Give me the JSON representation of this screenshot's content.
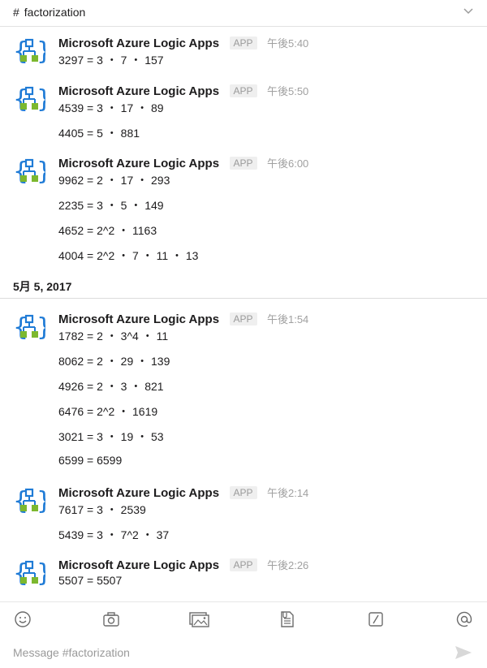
{
  "channel": {
    "hash": "#",
    "name": "factorization"
  },
  "app_name": "Microsoft Azure Logic Apps",
  "app_badge": "APP",
  "groups": [
    {
      "time": "午後5:40",
      "messages": [
        "3297 = 3 ・ 7 ・ 157"
      ]
    },
    {
      "time": "午後5:50",
      "messages": [
        "4539 = 3 ・ 17 ・ 89",
        "4405 = 5 ・ 881"
      ]
    },
    {
      "time": "午後6:00",
      "messages": [
        "9962 = 2 ・ 17 ・ 293",
        "2235 = 3 ・ 5 ・ 149",
        "4652 = 2^2 ・ 1163",
        "4004 = 2^2 ・ 7 ・ 11 ・ 13"
      ]
    },
    {
      "time": "午後1:54",
      "messages": [
        "1782 = 2 ・ 3^4 ・ 11",
        "8062 = 2 ・ 29 ・ 139",
        "4926 = 2 ・ 3 ・ 821",
        "6476 = 2^2 ・ 1619",
        "3021 = 3 ・ 19 ・ 53",
        "6599 = 6599"
      ]
    },
    {
      "time": "午後2:14",
      "messages": [
        "7617 = 3 ・ 2539",
        "5439 = 3 ・ 7^2 ・ 37"
      ]
    },
    {
      "time": "午後2:26",
      "messages": [
        "5507 = 5507"
      ]
    }
  ],
  "date_divider": "5月 5, 2017",
  "composer": {
    "placeholder": "Message #factorization"
  },
  "toolbar": {
    "icons": [
      "emoji-icon",
      "camera-icon",
      "photo-icon",
      "file-icon",
      "slash-command-icon",
      "mention-icon"
    ]
  },
  "colors": {
    "logic_blue": "#1f7bd6",
    "logic_green": "#7cb82f"
  }
}
